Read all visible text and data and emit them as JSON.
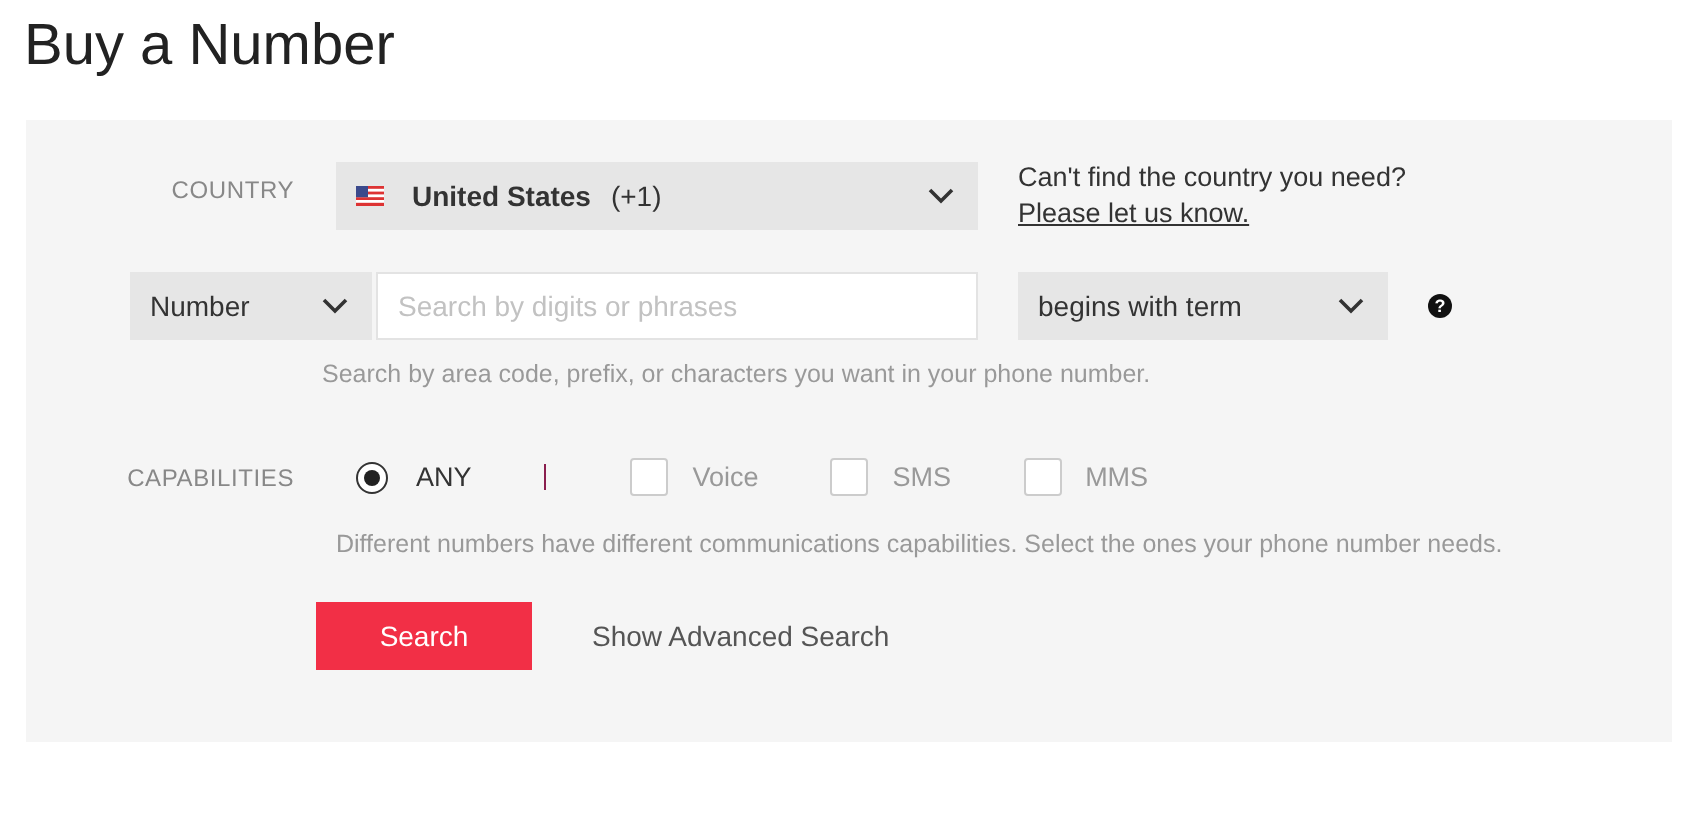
{
  "title": "Buy a Number",
  "country": {
    "label": "COUNTRY",
    "name": "United States",
    "code": "(+1)",
    "help_text": "Can't find the country you need?",
    "help_link": "Please let us know."
  },
  "search": {
    "type_select": "Number",
    "placeholder": "Search by digits or phrases",
    "match_select": "begins with term",
    "help_icon": "?",
    "hint": "Search by area code, prefix, or characters you want in your phone number."
  },
  "capabilities": {
    "label": "CAPABILITIES",
    "options": [
      {
        "kind": "radio",
        "label": "ANY",
        "checked": true
      },
      {
        "kind": "checkbox",
        "label": "Voice",
        "checked": false
      },
      {
        "kind": "checkbox",
        "label": "SMS",
        "checked": false
      },
      {
        "kind": "checkbox",
        "label": "MMS",
        "checked": false
      }
    ],
    "hint": "Different numbers have different communications capabilities. Select the ones your phone number needs."
  },
  "buttons": {
    "primary": "Search",
    "secondary": "Show Advanced Search"
  }
}
